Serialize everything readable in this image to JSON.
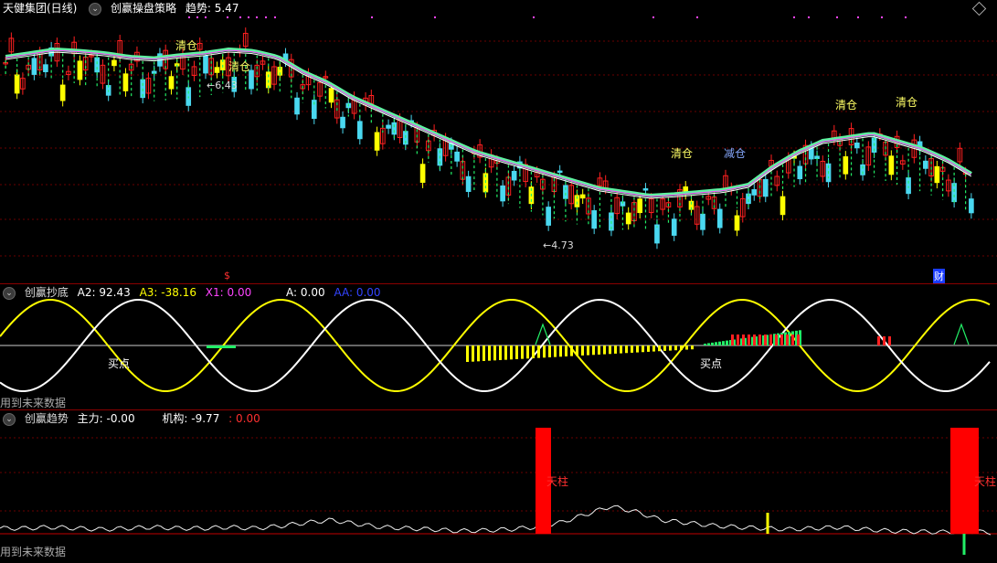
{
  "main": {
    "stock": "天健集团(日线)",
    "indicator": "创赢操盘策略",
    "trend_label": "趋势: 5.47",
    "labels": {
      "clear": "清仓",
      "reduce": "减仓"
    },
    "price_high": "6.43",
    "price_low": "4.73",
    "markers": {
      "s": "$",
      "cai": "财"
    }
  },
  "osc": {
    "name": "创赢抄底",
    "a2": "A2: 92.43",
    "a3": "A3: -38.16",
    "x1": "X1: 0.00",
    "a": "A: 0.00",
    "aa": "AA: 0.00",
    "buy": "买点",
    "future": "用到未来数据"
  },
  "trend": {
    "name": "创赢趋势",
    "zhuli": "主力: -0.00",
    "jigou": "机构: -9.77",
    "extra": ": 0.00",
    "pillar": "天柱",
    "future": "用到未来数据"
  },
  "colors": {
    "up": "#ff2020",
    "down": "#4ad8f0",
    "yellow": "#ffff00",
    "green": "#22ee66",
    "white": "#ffffff",
    "magenta": "#ff44ff"
  },
  "chart_data": {
    "type": "line",
    "price_ma": [
      7.2,
      7.25,
      7.3,
      7.28,
      7.25,
      7.2,
      7.18,
      7.22,
      7.25,
      7.3,
      7.28,
      7.2,
      7.0,
      6.85,
      6.65,
      6.5,
      6.35,
      6.2,
      6.05,
      5.9,
      5.8,
      5.7,
      5.6,
      5.5,
      5.4,
      5.35,
      5.3,
      5.32,
      5.35,
      5.38,
      5.45,
      5.7,
      5.9,
      6.05,
      6.1,
      6.15,
      6.05,
      5.95,
      5.8,
      5.6
    ],
    "clear_signals": 5,
    "osc_a2": [
      50,
      10,
      -60,
      -90,
      -30,
      60,
      95,
      70,
      0,
      -70,
      -95,
      -50,
      30,
      85,
      90,
      40,
      -30,
      -85,
      -90,
      -40,
      40,
      90,
      80,
      20,
      -50,
      -92,
      -70,
      0,
      70,
      95,
      60,
      -20,
      -80,
      -90,
      -40,
      30,
      85,
      92,
      60,
      -30
    ],
    "trend_main": [
      0.1,
      0.1,
      0.12,
      0.1,
      0.08,
      0.1,
      0.12,
      0.1,
      0.1,
      0.12,
      0.1,
      0.14,
      0.2,
      0.25,
      0.18,
      0.12,
      0.1,
      0.08,
      0.05,
      0.06,
      0.08,
      0.12,
      0.2,
      0.35,
      0.5,
      0.4,
      0.25,
      0.2,
      0.15,
      0.12,
      0.1,
      0.08,
      0.1,
      0.12,
      0.08,
      0.05,
      0.04,
      0.03,
      0.05,
      0.02
    ]
  }
}
